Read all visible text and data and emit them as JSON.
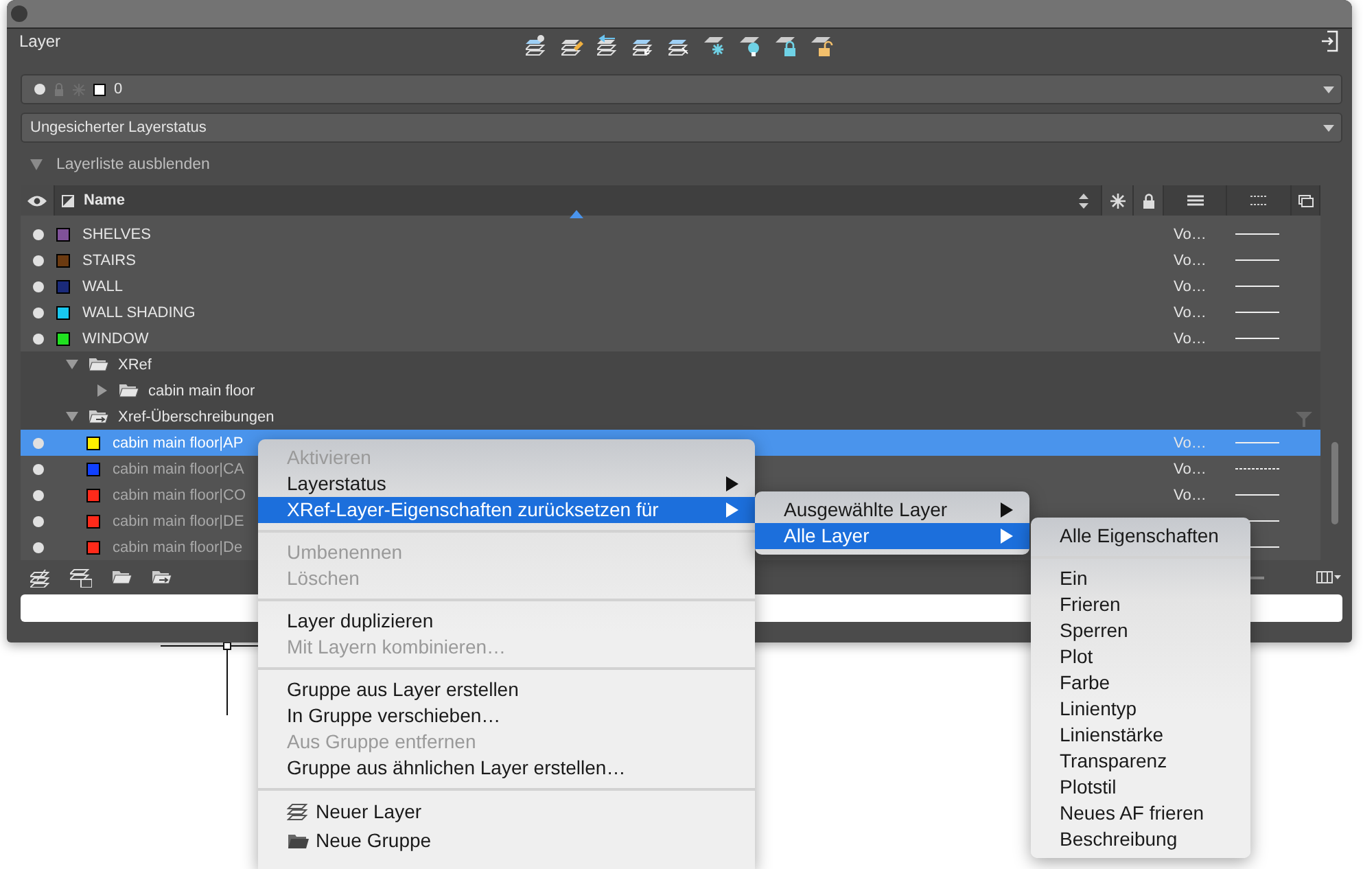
{
  "palette": {
    "title": "Layer",
    "current_layer": {
      "name": "0",
      "color": "#ffffff",
      "on": true
    },
    "layer_state": {
      "value": "Ungesicherter Layerstatus"
    },
    "list_toggle": {
      "label": "Layerliste ausblenden",
      "expanded": true
    },
    "name_column": "Name",
    "tree": [
      {
        "kind": "layer",
        "name": "SHELVES",
        "color": "#80529a",
        "on": true,
        "lineweight": "Vo…",
        "linetype_dashed": false,
        "selected": false
      },
      {
        "kind": "layer",
        "name": "STAIRS",
        "color": "#6b3a10",
        "on": true,
        "lineweight": "Vo…",
        "linetype_dashed": false,
        "selected": false
      },
      {
        "kind": "layer",
        "name": "WALL",
        "color": "#1a2a7a",
        "on": true,
        "lineweight": "Vo…",
        "linetype_dashed": false,
        "selected": false
      },
      {
        "kind": "layer",
        "name": "WALL SHADING",
        "color": "#18c8f0",
        "on": true,
        "lineweight": "Vo…",
        "linetype_dashed": false,
        "selected": false
      },
      {
        "kind": "layer",
        "name": "WINDOW",
        "color": "#20e020",
        "on": true,
        "lineweight": "Vo…",
        "linetype_dashed": false,
        "selected": false
      },
      {
        "kind": "group",
        "name": "XRef",
        "expanded": true,
        "children": [
          {
            "kind": "group",
            "name": "cabin main floor",
            "expanded": false
          }
        ]
      },
      {
        "kind": "override_group",
        "name": "Xref-Überschreibungen",
        "expanded": true,
        "children": [
          {
            "kind": "layer",
            "name": "cabin main floor|AP",
            "color": "#ffee00",
            "on": true,
            "lineweight": "Vo…",
            "linetype_dashed": false,
            "selected": true
          },
          {
            "kind": "layer",
            "name": "cabin main floor|CA",
            "color": "#1040ff",
            "on": true,
            "lineweight": "Vo…",
            "linetype_dashed": true,
            "selected": false
          },
          {
            "kind": "layer",
            "name": "cabin main floor|CO",
            "color": "#ff2a1a",
            "on": true,
            "lineweight": "Vo…",
            "linetype_dashed": false,
            "selected": false
          },
          {
            "kind": "layer",
            "name": "cabin main floor|DE",
            "color": "#ff2a1a",
            "on": true,
            "linetype_dashed": false,
            "selected": false
          },
          {
            "kind": "layer",
            "name": "cabin main floor|De",
            "color": "#ff2a1a",
            "on": true,
            "linetype_dashed": false,
            "selected": false
          }
        ]
      }
    ]
  },
  "menus": [
    {
      "items": [
        {
          "kind": "item",
          "label": "Aktivieren",
          "disabled": true,
          "selected": false,
          "submenu": false
        },
        {
          "kind": "item",
          "label": "Layerstatus",
          "disabled": false,
          "selected": false,
          "submenu": true
        },
        {
          "kind": "item",
          "label": "XRef-Layer-Eigenschaften zurücksetzen für",
          "disabled": false,
          "selected": true,
          "submenu": true
        },
        {
          "kind": "separator"
        },
        {
          "kind": "item",
          "label": "Umbenennen",
          "disabled": true,
          "selected": false,
          "submenu": false
        },
        {
          "kind": "item",
          "label": "Löschen",
          "disabled": true,
          "selected": false,
          "submenu": false
        },
        {
          "kind": "separator"
        },
        {
          "kind": "item",
          "label": "Layer duplizieren",
          "disabled": false,
          "selected": false,
          "submenu": false
        },
        {
          "kind": "item",
          "label": "Mit Layern kombinieren…",
          "disabled": true,
          "selected": false,
          "submenu": false
        },
        {
          "kind": "separator"
        },
        {
          "kind": "item",
          "label": "Gruppe aus Layer erstellen",
          "disabled": false,
          "selected": false,
          "submenu": false
        },
        {
          "kind": "item",
          "label": "In Gruppe verschieben…",
          "disabled": false,
          "selected": false,
          "submenu": false
        },
        {
          "kind": "item",
          "label": "Aus Gruppe entfernen",
          "disabled": true,
          "selected": false,
          "submenu": false
        },
        {
          "kind": "item",
          "label": "Gruppe aus ähnlichen Layer erstellen…",
          "disabled": false,
          "selected": false,
          "submenu": false
        },
        {
          "kind": "separator"
        },
        {
          "kind": "icon_item",
          "label": "Neuer Layer",
          "disabled": false,
          "selected": false,
          "submenu": false
        },
        {
          "kind": "icon_item",
          "label": "Neue Gruppe",
          "disabled": false,
          "selected": false,
          "submenu": false
        }
      ]
    },
    {
      "items": [
        {
          "kind": "item",
          "label": "Ausgewählte Layer",
          "disabled": false,
          "selected": false,
          "submenu": true
        },
        {
          "kind": "item",
          "label": "Alle Layer",
          "disabled": false,
          "selected": true,
          "submenu": true
        }
      ]
    },
    {
      "items": [
        {
          "kind": "item",
          "label": "Alle Eigenschaften",
          "disabled": false,
          "selected": false,
          "submenu": false
        },
        {
          "kind": "separator"
        },
        {
          "kind": "item",
          "label": "Ein",
          "disabled": false,
          "selected": false,
          "submenu": false
        },
        {
          "kind": "item",
          "label": "Frieren",
          "disabled": false,
          "selected": false,
          "submenu": false
        },
        {
          "kind": "item",
          "label": "Sperren",
          "disabled": false,
          "selected": false,
          "submenu": false
        },
        {
          "kind": "item",
          "label": "Plot",
          "disabled": false,
          "selected": false,
          "submenu": false
        },
        {
          "kind": "item",
          "label": "Farbe",
          "disabled": false,
          "selected": false,
          "submenu": false
        },
        {
          "kind": "item",
          "label": "Linientyp",
          "disabled": false,
          "selected": false,
          "submenu": false
        },
        {
          "kind": "item",
          "label": "Linienstärke",
          "disabled": false,
          "selected": false,
          "submenu": false
        },
        {
          "kind": "item",
          "label": "Transparenz",
          "disabled": false,
          "selected": false,
          "submenu": false
        },
        {
          "kind": "item",
          "label": "Plotstil",
          "disabled": false,
          "selected": false,
          "submenu": false
        },
        {
          "kind": "item",
          "label": "Neues AF frieren",
          "disabled": false,
          "selected": false,
          "submenu": false
        },
        {
          "kind": "item",
          "label": "Beschreibung",
          "disabled": false,
          "selected": false,
          "submenu": false
        }
      ]
    }
  ]
}
